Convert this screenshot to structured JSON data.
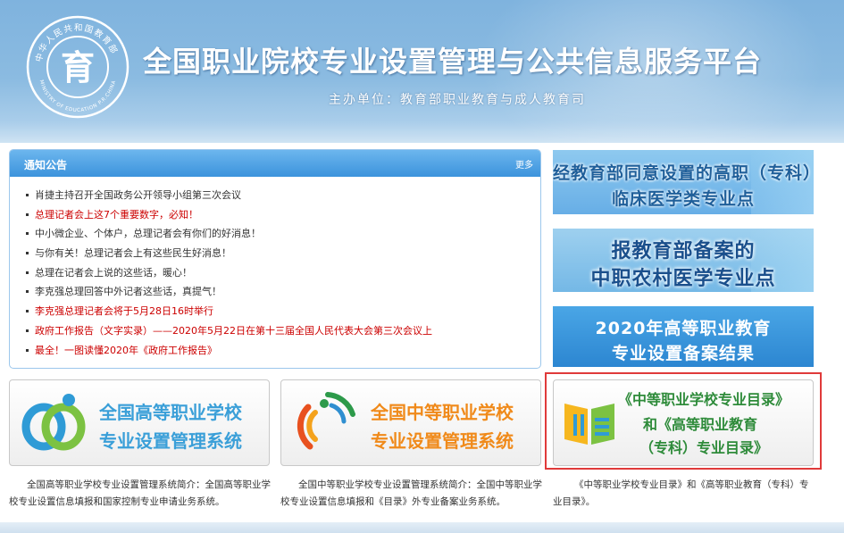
{
  "header": {
    "title": "全国职业院校专业设置管理与公共信息服务平台",
    "sponsor": "主办单位：教育部职业教育与成人教育司",
    "emblem_top_text": "中华人民共和国教育部",
    "emblem_bottom_text": "MINISTRY OF EDUCATION P.R.CHINA",
    "emblem_center": "育"
  },
  "notice": {
    "title": "通知公告",
    "more": "更多",
    "items": [
      {
        "text": "肖捷主持召开全国政务公开领导小组第三次会议",
        "color": "#333333"
      },
      {
        "text": "总理记者会上这7个重要数字，必知！",
        "color": "#cc0000"
      },
      {
        "text": "中小微企业、个体户，总理记者会有你们的好消息！",
        "color": "#333333"
      },
      {
        "text": "与你有关！总理记者会上有这些民生好消息！",
        "color": "#333333"
      },
      {
        "text": "总理在记者会上说的这些话，暖心！",
        "color": "#333333"
      },
      {
        "text": "李克强总理回答中外记者这些话，真提气！",
        "color": "#333333"
      },
      {
        "text": "李克强总理记者会将于5月28日16时举行",
        "color": "#cc0000"
      },
      {
        "text": "政府工作报告（文字实录）——2020年5月22日在第十三届全国人民代表大会第三次会议上",
        "color": "#cc0000"
      },
      {
        "text": "最全！一图读懂2020年《政府工作报告》",
        "color": "#cc0000"
      }
    ]
  },
  "banners": [
    {
      "line1": "经教育部同意设置的高职（专科）",
      "line2": "临床医学类专业点"
    },
    {
      "line1": "报教育部备案的",
      "line2": "中职农村医学专业点"
    },
    {
      "line1": "2020年高等职业教育",
      "line2": "专业设置备案结果"
    }
  ],
  "cards": [
    {
      "line1": "全国高等职业学校",
      "line2": "专业设置管理系统",
      "text_color": "#3a9fd8",
      "desc": "全国高等职业学校专业设置管理系统简介：全国高等职业学校专业设置信息填报和国家控制专业申请业务系统。"
    },
    {
      "line1": "全国中等职业学校",
      "line2": "专业设置管理系统",
      "text_color": "#f08a1a",
      "desc": "全国中等职业学校专业设置管理系统简介：全国中等职业学校专业设置信息填报和《目录》外专业备案业务系统。"
    },
    {
      "line1": "《中等职业学校专业目录》",
      "line2": "和《高等职业教育",
      "line3": "（专科）专业目录》",
      "text_color": "#2e8b3a",
      "desc": "《中等职业学校专业目录》和《高等职业教育（专科）专业目录》。"
    }
  ],
  "colors": {
    "header_blue": "#7fb3de",
    "notice_head": "#3c93dc",
    "highlight_red": "#e03a3a"
  }
}
